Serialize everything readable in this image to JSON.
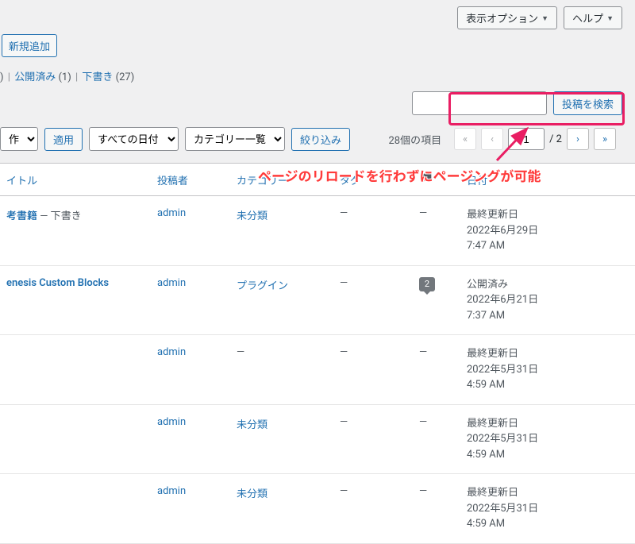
{
  "top": {
    "screen_options": "表示オプション",
    "help": "ヘルプ",
    "add_new": "新規追加"
  },
  "status_filter": {
    "all_suffix": ")",
    "published": "公開済み",
    "published_count": "(1)",
    "draft": "下書き",
    "draft_count": "(27)"
  },
  "search": {
    "button": "投稿を検索"
  },
  "filters": {
    "bulk_action": "作",
    "apply": "適用",
    "all_dates": "すべての日付",
    "all_categories": "カテゴリー一覧",
    "filter": "絞り込み"
  },
  "pagination": {
    "count_text": "28個の項目",
    "current": "1",
    "total": "/ 2",
    "first": "«",
    "prev": "‹",
    "next": "›",
    "last": "»"
  },
  "annotation": {
    "text": "ページのリロードを行わずにページングが可能"
  },
  "columns": {
    "title": "イトル",
    "author": "投稿者",
    "categories": "カテゴリー",
    "tags": "タグ",
    "date": "日付"
  },
  "rows": [
    {
      "title": "考書籍",
      "title_suffix": " — 下書き",
      "author": "admin",
      "category": "未分類",
      "category_is_link": true,
      "tags": "—",
      "comments": "—",
      "date_status": "最終更新日",
      "date_line1": "2022年6月29日",
      "date_line2": "7:47 AM"
    },
    {
      "title": "enesis Custom Blocks",
      "title_suffix": "",
      "author": "admin",
      "category": "プラグイン",
      "category_is_link": true,
      "tags": "—",
      "comments_bubble": "2",
      "date_status": "公開済み",
      "date_line1": "2022年6月21日",
      "date_line2": "7:37 AM"
    },
    {
      "title": "",
      "title_suffix": "",
      "author": "admin",
      "category": "—",
      "category_is_link": false,
      "tags": "—",
      "comments": "—",
      "date_status": "最終更新日",
      "date_line1": "2022年5月31日",
      "date_line2": "4:59 AM"
    },
    {
      "title": "",
      "title_suffix": "",
      "author": "admin",
      "category": "未分類",
      "category_is_link": true,
      "tags": "—",
      "comments": "—",
      "date_status": "最終更新日",
      "date_line1": "2022年5月31日",
      "date_line2": "4:59 AM"
    },
    {
      "title": "",
      "title_suffix": "",
      "author": "admin",
      "category": "未分類",
      "category_is_link": true,
      "tags": "—",
      "comments": "—",
      "date_status": "最終更新日",
      "date_line1": "2022年5月31日",
      "date_line2": "4:59 AM"
    }
  ]
}
